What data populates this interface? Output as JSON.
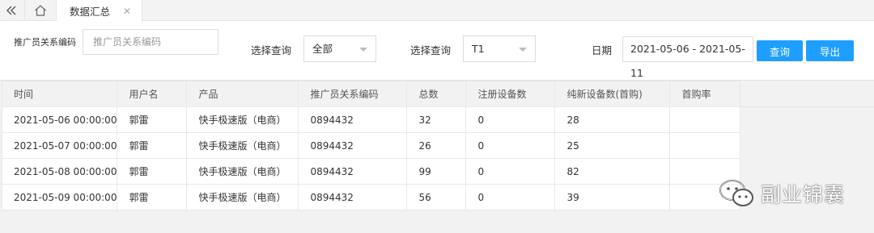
{
  "tabbar": {
    "back_icon": "double-chevron-left-icon",
    "home_icon": "home-icon",
    "active_tab": {
      "label": "数据汇总",
      "close_icon": "close-icon"
    }
  },
  "filters": {
    "promoter_code_label": "推广员关系编码",
    "promoter_code_placeholder": "推广员关系编码",
    "query1_label": "选择查询",
    "query1_value": "全部",
    "query2_label": "选择查询",
    "query2_value": "T1",
    "date_label": "日期",
    "date_value": "2021-05-06 - 2021-05-11",
    "query_button": "查询",
    "export_button": "导出",
    "accent_color": "#1e9fff"
  },
  "table": {
    "columns": [
      "时间",
      "用户名",
      "产品",
      "推广员关系编码",
      "总数",
      "注册设备数",
      "纯新设备数(首购)",
      "首购率"
    ],
    "rows": [
      [
        "2021-05-06 00:00:00",
        "郭雷",
        "快手极速版（电商）",
        "0894432",
        "32",
        "0",
        "28",
        ""
      ],
      [
        "2021-05-07 00:00:00",
        "郭雷",
        "快手极速版（电商）",
        "0894432",
        "26",
        "0",
        "25",
        ""
      ],
      [
        "2021-05-08 00:00:00",
        "郭雷",
        "快手极速版（电商）",
        "0894432",
        "99",
        "0",
        "82",
        ""
      ],
      [
        "2021-05-09 00:00:00",
        "郭雷",
        "快手极速版（电商）",
        "0894432",
        "56",
        "0",
        "39",
        ""
      ]
    ]
  },
  "watermark": {
    "icon": "wechat-icon",
    "text": "副业锦囊"
  }
}
